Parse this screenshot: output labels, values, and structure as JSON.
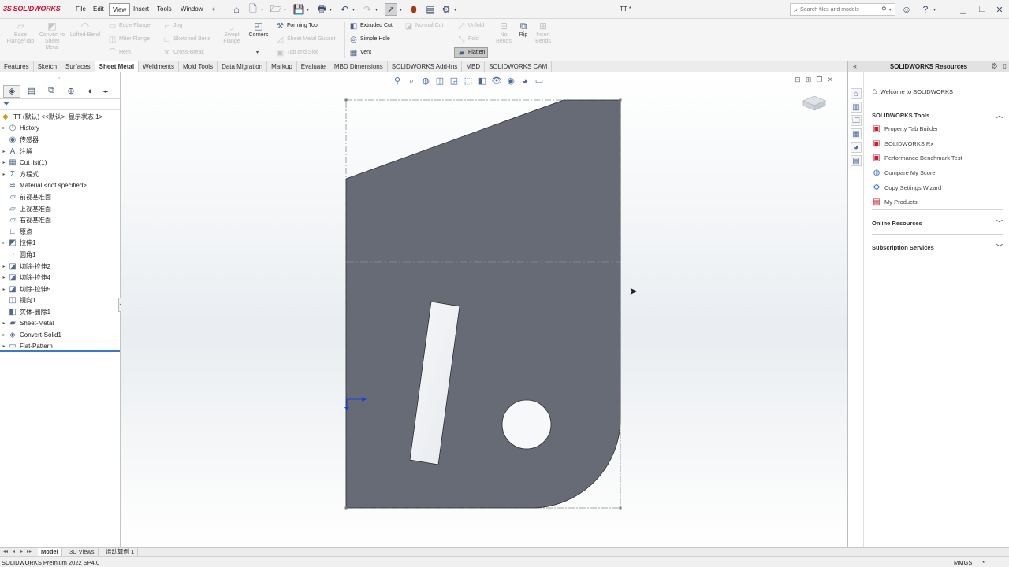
{
  "app": {
    "logo_mark": "3S",
    "logo_text": "SOLIDWORKS",
    "document_title": "TT *"
  },
  "menu": {
    "items": [
      "File",
      "Edit",
      "View",
      "Insert",
      "Tools",
      "Window"
    ],
    "active": "View"
  },
  "search": {
    "placeholder": "Search files and models"
  },
  "commands": {
    "base_flange": "Base Flange/Tab",
    "convert": "Convert to Sheet Metal",
    "lofted_bend": "Lofted-Bend",
    "edge_flange": "Edge Flange",
    "miter_flange": "Miter Flange",
    "hem": "Hem",
    "jog": "Jog",
    "sketched_bend": "Sketched Bend",
    "cross_break": "Cross-Break",
    "swept_flange": "Swept Flange",
    "corners": "Corners",
    "forming_tool": "Forming Tool",
    "sheet_metal_gusset": "Sheet Metal Gusset",
    "tab_and_slot": "Tab and Slot",
    "extruded_cut": "Extruded Cut",
    "simple_hole": "Simple Hole",
    "vent": "Vent",
    "normal_cut": "Normal Cut",
    "unfold": "Unfold",
    "fold": "Fold",
    "flatten": "Flatten",
    "no_bends": "No Bends",
    "rip": "Rip",
    "insert_bends": "Insert Bends"
  },
  "tabs": {
    "items": [
      "Features",
      "Sketch",
      "Surfaces",
      "Sheet Metal",
      "Weldments",
      "Mold Tools",
      "Data Migration",
      "Markup",
      "Evaluate",
      "MBD Dimensions",
      "SOLIDWORKS Add-Ins",
      "MBD",
      "SOLIDWORKS CAM"
    ],
    "active": "Sheet Metal"
  },
  "feature_tree": {
    "root": "TT (默认) <<默认>_显示状态 1>",
    "nodes": [
      {
        "label": "History",
        "expandable": true,
        "icon": "history-icon"
      },
      {
        "label": "传感器",
        "expandable": false,
        "icon": "sensor-icon"
      },
      {
        "label": "注解",
        "expandable": true,
        "icon": "annotation-icon"
      },
      {
        "label": "Cut list(1)",
        "expandable": true,
        "icon": "cut-list-icon"
      },
      {
        "label": "方程式",
        "expandable": true,
        "icon": "equation-icon"
      },
      {
        "label": "Material <not specified>",
        "expandable": false,
        "icon": "material-icon"
      },
      {
        "label": "前视基准面",
        "expandable": false,
        "icon": "plane-icon"
      },
      {
        "label": "上视基准面",
        "expandable": false,
        "icon": "plane-icon"
      },
      {
        "label": "右视基准面",
        "expandable": false,
        "icon": "plane-icon"
      },
      {
        "label": "原点",
        "expandable": false,
        "icon": "origin-icon"
      },
      {
        "label": "拉伸1",
        "expandable": true,
        "icon": "extrude-icon"
      },
      {
        "label": "圆角1",
        "expandable": false,
        "icon": "fillet-icon"
      },
      {
        "label": "切除-拉伸2",
        "expandable": true,
        "icon": "cut-extrude-icon"
      },
      {
        "label": "切除-拉伸4",
        "expandable": true,
        "icon": "cut-extrude-icon"
      },
      {
        "label": "切除-拉伸5",
        "expandable": true,
        "icon": "cut-extrude-icon"
      },
      {
        "label": "镜向1",
        "expandable": false,
        "icon": "mirror-icon"
      },
      {
        "label": "实体-删除1",
        "expandable": false,
        "icon": "body-delete-icon"
      },
      {
        "label": "Sheet-Metal",
        "expandable": true,
        "icon": "sheet-metal-icon"
      },
      {
        "label": "Convert-Solid1",
        "expandable": true,
        "icon": "convert-solid-icon"
      },
      {
        "label": "Flat-Pattern",
        "expandable": true,
        "icon": "flat-pattern-icon"
      }
    ]
  },
  "task_pane": {
    "title": "SOLIDWORKS Resources",
    "welcome": "Welcome to SOLIDWORKS",
    "tools_header": "SOLIDWORKS Tools",
    "tools": [
      "Property Tab Builder",
      "SOLIDWORKS Rx",
      "Performance Benchmark Test",
      "Compare My Score",
      "Copy Settings Wizard",
      "My Products"
    ],
    "online_header": "Online Resources",
    "subscription_header": "Subscription Services"
  },
  "bottom_tabs": {
    "items": [
      "Model",
      "3D Views",
      "运动算例 1"
    ],
    "active": "Model"
  },
  "status": {
    "version": "SOLIDWORKS Premium 2022 SP4.0",
    "units": "MMGS"
  },
  "colors": {
    "part_fill": "#666b76",
    "accent_red": "#c8102e",
    "tree_highlight": "#3a78c8"
  }
}
